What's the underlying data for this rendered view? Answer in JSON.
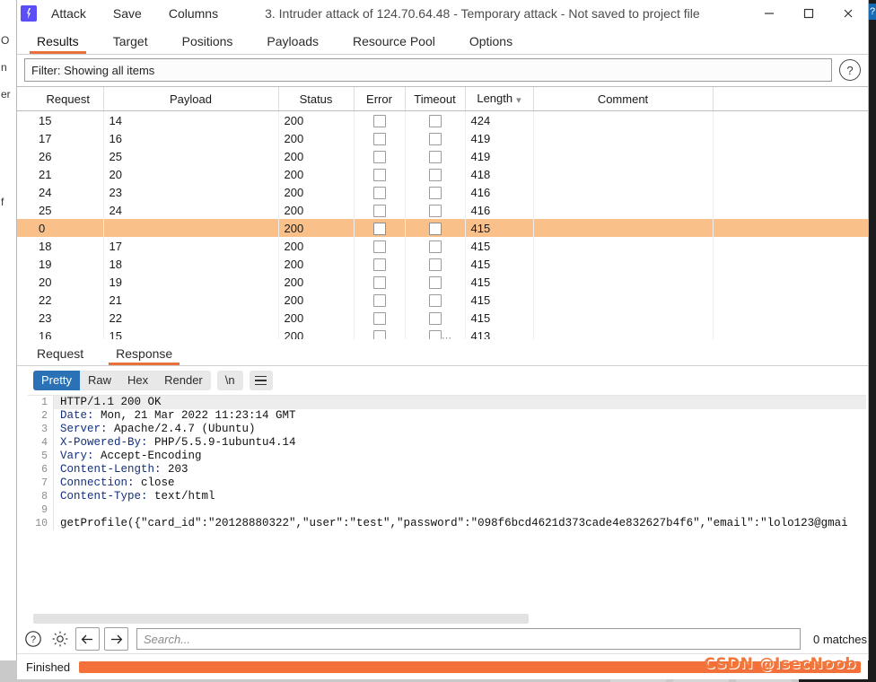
{
  "window": {
    "title": "3. Intruder attack of 124.70.64.48 - Temporary attack - Not saved to project file",
    "logo_icon": "burp-lightning-icon",
    "menus": [
      "Attack",
      "Save",
      "Columns"
    ],
    "controls": {
      "minimize": "minimize-icon",
      "maximize": "maximize-icon",
      "close": "close-icon"
    }
  },
  "tabs": [
    {
      "label": "Results",
      "active": true
    },
    {
      "label": "Target",
      "active": false
    },
    {
      "label": "Positions",
      "active": false
    },
    {
      "label": "Payloads",
      "active": false
    },
    {
      "label": "Resource Pool",
      "active": false
    },
    {
      "label": "Options",
      "active": false
    }
  ],
  "filter": {
    "text": "Filter: Showing all items",
    "help_icon": "question-mark-icon"
  },
  "results_table": {
    "columns": [
      "Request",
      "Payload",
      "Status",
      "Error",
      "Timeout",
      "Length",
      "Comment"
    ],
    "sorted_column": "Length",
    "sort_icon": "chevron-down-icon",
    "rows": [
      {
        "request": "15",
        "payload": "14",
        "status": "200",
        "error": false,
        "timeout": false,
        "length": "424",
        "comment": "",
        "selected": false
      },
      {
        "request": "17",
        "payload": "16",
        "status": "200",
        "error": false,
        "timeout": false,
        "length": "419",
        "comment": "",
        "selected": false
      },
      {
        "request": "26",
        "payload": "25",
        "status": "200",
        "error": false,
        "timeout": false,
        "length": "419",
        "comment": "",
        "selected": false
      },
      {
        "request": "21",
        "payload": "20",
        "status": "200",
        "error": false,
        "timeout": false,
        "length": "418",
        "comment": "",
        "selected": false
      },
      {
        "request": "24",
        "payload": "23",
        "status": "200",
        "error": false,
        "timeout": false,
        "length": "416",
        "comment": "",
        "selected": false
      },
      {
        "request": "25",
        "payload": "24",
        "status": "200",
        "error": false,
        "timeout": false,
        "length": "416",
        "comment": "",
        "selected": false
      },
      {
        "request": "0",
        "payload": "",
        "status": "200",
        "error": false,
        "timeout": false,
        "length": "415",
        "comment": "",
        "selected": true
      },
      {
        "request": "18",
        "payload": "17",
        "status": "200",
        "error": false,
        "timeout": false,
        "length": "415",
        "comment": "",
        "selected": false
      },
      {
        "request": "19",
        "payload": "18",
        "status": "200",
        "error": false,
        "timeout": false,
        "length": "415",
        "comment": "",
        "selected": false
      },
      {
        "request": "20",
        "payload": "19",
        "status": "200",
        "error": false,
        "timeout": false,
        "length": "415",
        "comment": "",
        "selected": false
      },
      {
        "request": "22",
        "payload": "21",
        "status": "200",
        "error": false,
        "timeout": false,
        "length": "415",
        "comment": "",
        "selected": false
      },
      {
        "request": "23",
        "payload": "22",
        "status": "200",
        "error": false,
        "timeout": false,
        "length": "415",
        "comment": "",
        "selected": false
      },
      {
        "request": "16",
        "payload": "15",
        "status": "200",
        "error": false,
        "timeout": false,
        "length": "413",
        "comment": "",
        "selected": false
      }
    ]
  },
  "message_tabs": [
    {
      "label": "Request",
      "active": false
    },
    {
      "label": "Response",
      "active": true
    }
  ],
  "view_modes": [
    {
      "label": "Pretty",
      "active": true
    },
    {
      "label": "Raw",
      "active": false
    },
    {
      "label": "Hex",
      "active": false
    },
    {
      "label": "Render",
      "active": false
    }
  ],
  "extra_buttons": {
    "newline": "\\n",
    "menu_icon": "hamburger-menu-icon"
  },
  "response": {
    "lines": [
      {
        "n": "1",
        "key": "",
        "value": "HTTP/1.1 200 OK"
      },
      {
        "n": "2",
        "key": "Date:",
        "value": " Mon, 21 Mar 2022 11:23:14 GMT"
      },
      {
        "n": "3",
        "key": "Server:",
        "value": " Apache/2.4.7 (Ubuntu)"
      },
      {
        "n": "4",
        "key": "X-Powered-By:",
        "value": " PHP/5.5.9-1ubuntu4.14"
      },
      {
        "n": "5",
        "key": "Vary:",
        "value": " Accept-Encoding"
      },
      {
        "n": "6",
        "key": "Content-Length:",
        "value": " 203"
      },
      {
        "n": "7",
        "key": "Connection:",
        "value": " close"
      },
      {
        "n": "8",
        "key": "Content-Type:",
        "value": " text/html"
      },
      {
        "n": "9",
        "key": "",
        "value": ""
      },
      {
        "n": "10",
        "key": "",
        "value": "getProfile({\"card_id\":\"20128880322\",\"user\":\"test\",\"password\":\"098f6bcd4621d373cade4e832627b4f6\",\"email\":\"lolo123@gmai"
      }
    ]
  },
  "search": {
    "placeholder": "Search...",
    "value": "",
    "matches": "0 matches",
    "help_icon": "question-mark-icon",
    "settings_icon": "gear-icon",
    "prev_icon": "arrow-left-icon",
    "next_icon": "arrow-right-icon"
  },
  "status": {
    "text": "Finished",
    "progress_percent": 100,
    "progress_color": "#f4703a"
  },
  "watermark": "CSDN @IsecNoob",
  "background_window_text": [
    "O",
    "n",
    "er",
    "f"
  ]
}
